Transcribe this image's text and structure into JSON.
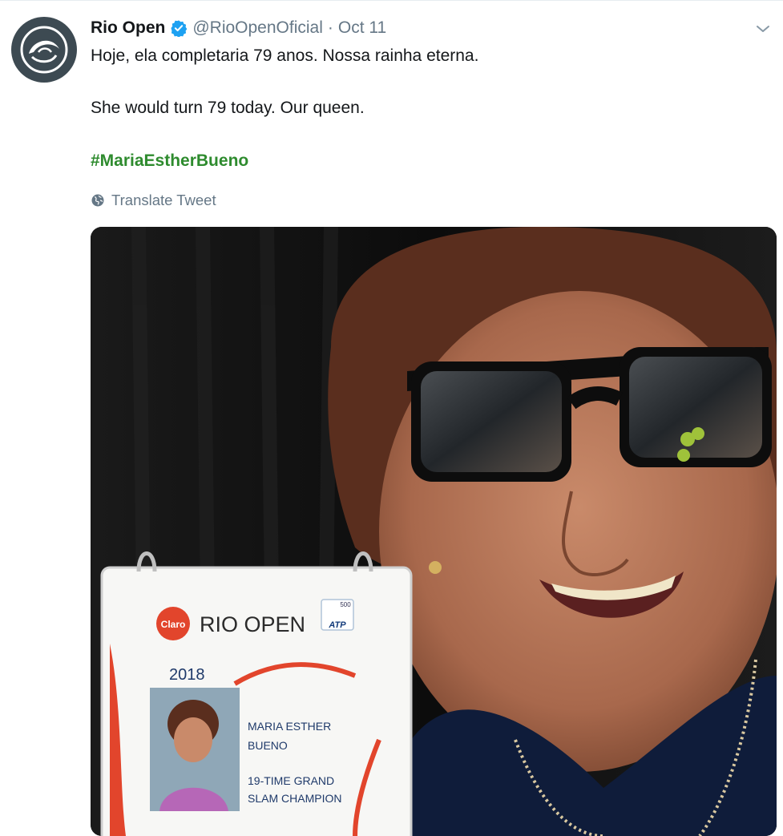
{
  "tweet": {
    "author_name": "Rio Open",
    "handle": "@RioOpenOficial",
    "separator": "·",
    "timestamp": "Oct 11",
    "text_line_1": "Hoje, ela completaria 79 anos. Nossa rainha eterna.",
    "text_line_2": "She would turn 79 today. Our queen.",
    "hashtag": "#MariaEstherBueno",
    "translate_label": "Translate Tweet"
  },
  "media": {
    "badge": {
      "sponsor": "Claro",
      "event": "RIO OPEN",
      "tour": "ATP",
      "tier": "500",
      "year": "2018",
      "name_line_1": "MARIA ESTHER",
      "name_line_2": "BUENO",
      "title_line_1": "19-TIME GRAND",
      "title_line_2": "SLAM CHAMPION"
    }
  },
  "icons": {
    "avatar": "rio-open-logo-icon",
    "verified": "verified-badge-icon",
    "more": "chevron-down-icon",
    "translate": "globe-icon"
  },
  "colors": {
    "verified": "#1da1f2",
    "hashtag": "#2e8b2e",
    "secondary_text": "#657786",
    "avatar_bg": "#3d4a52",
    "badge_accent": "#e2452c"
  }
}
